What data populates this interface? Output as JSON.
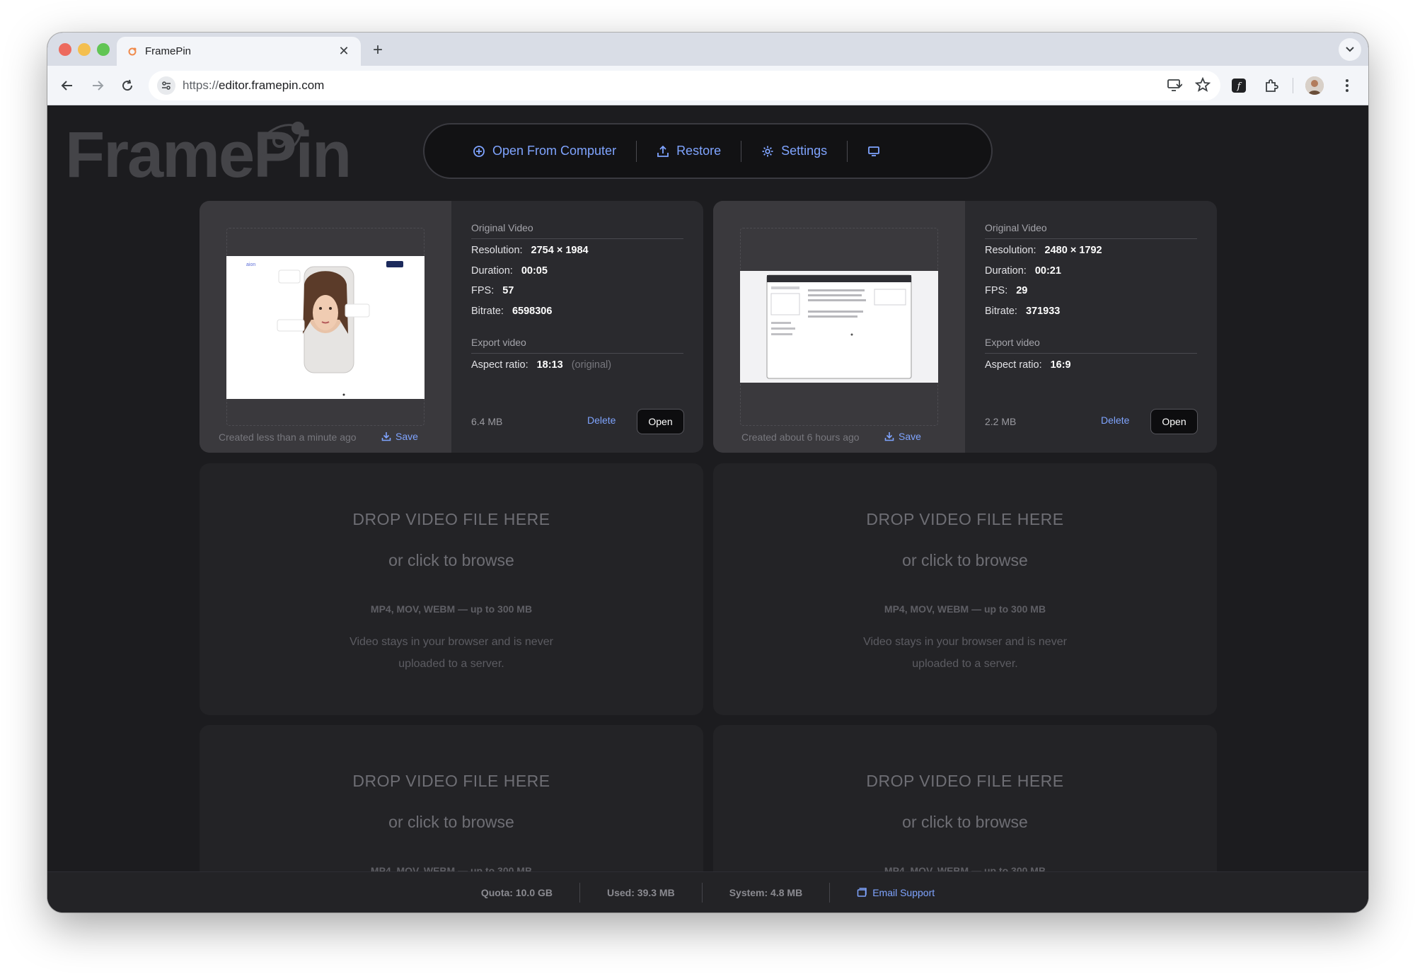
{
  "browser": {
    "tab_title": "FramePin",
    "url_scheme": "https://",
    "url_host": "editor.framepin.com"
  },
  "app": {
    "logo_text": "FramePin",
    "nav": {
      "open_label": "Open From Computer",
      "restore_label": "Restore",
      "settings_label": "Settings"
    }
  },
  "cards": [
    {
      "created": "Created less than a minute ago",
      "save_label": "Save",
      "original_title": "Original Video",
      "resolution_label": "Resolution:",
      "resolution": "2754 × 1984",
      "duration_label": "Duration:",
      "duration": "00:05",
      "fps_label": "FPS:",
      "fps": "57",
      "bitrate_label": "Bitrate:",
      "bitrate": "6598306",
      "export_title": "Export video",
      "aspect_label": "Aspect ratio:",
      "aspect": "18:13",
      "aspect_note": "(original)",
      "size": "6.4 MB",
      "delete_label": "Delete",
      "open_label": "Open"
    },
    {
      "created": "Created about 6 hours ago",
      "save_label": "Save",
      "original_title": "Original Video",
      "resolution_label": "Resolution:",
      "resolution": "2480 × 1792",
      "duration_label": "Duration:",
      "duration": "00:21",
      "fps_label": "FPS:",
      "fps": "29",
      "bitrate_label": "Bitrate:",
      "bitrate": "371933",
      "export_title": "Export video",
      "aspect_label": "Aspect ratio:",
      "aspect": "16:9",
      "aspect_note": "",
      "size": "2.2 MB",
      "delete_label": "Delete",
      "open_label": "Open"
    }
  ],
  "dropzone": {
    "title": "DROP VIDEO FILE HERE",
    "subtitle": "or click to browse",
    "formats": "MP4, MOV, WEBM — up to 300 MB",
    "privacy": "Video stays in your browser and is never uploaded to a server."
  },
  "footer": {
    "quota": "Quota: 10.0 GB",
    "used": "Used: 39.3 MB",
    "system": "System: 4.8 MB",
    "email_label": "Email Support"
  },
  "colors": {
    "accent": "#7fa4ff",
    "page_bg": "#1c1c1f",
    "card_bg": "#2a2a2e"
  }
}
